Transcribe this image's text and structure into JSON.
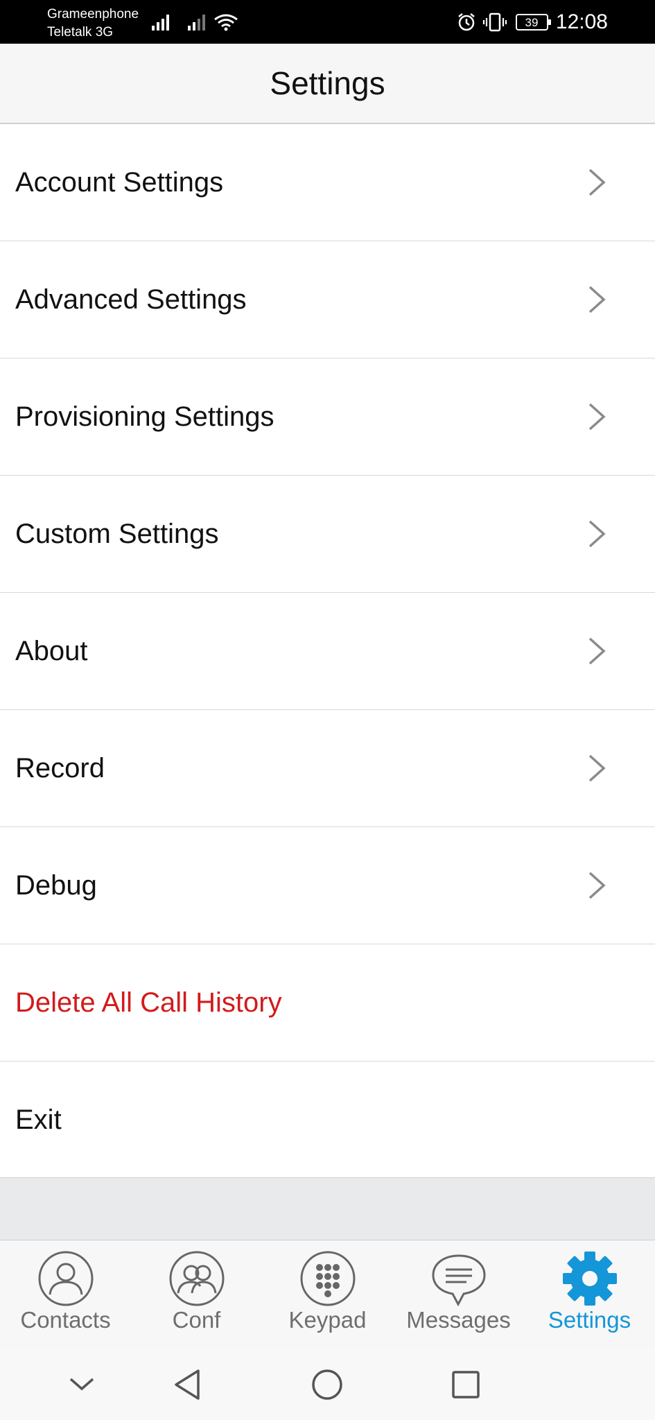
{
  "status_bar": {
    "carrier_1": "Grameenphone",
    "carrier_2": "Teletalk 3G",
    "battery": "39",
    "time": "12:08"
  },
  "header": {
    "title": "Settings"
  },
  "settings_items": [
    {
      "label": "Account Settings",
      "has_chevron": true
    },
    {
      "label": "Advanced Settings",
      "has_chevron": true
    },
    {
      "label": "Provisioning Settings",
      "has_chevron": true
    },
    {
      "label": "Custom Settings",
      "has_chevron": true
    },
    {
      "label": "About",
      "has_chevron": true
    },
    {
      "label": "Record",
      "has_chevron": true
    },
    {
      "label": "Debug",
      "has_chevron": true
    },
    {
      "label": "Delete All Call History",
      "has_chevron": false
    },
    {
      "label": "Exit",
      "has_chevron": false
    }
  ],
  "tabs": [
    {
      "label": "Contacts",
      "icon": "contact-icon",
      "active": false
    },
    {
      "label": "Conf",
      "icon": "conference-icon",
      "active": false
    },
    {
      "label": "Keypad",
      "icon": "keypad-icon",
      "active": false
    },
    {
      "label": "Messages",
      "icon": "messages-icon",
      "active": false
    },
    {
      "label": "Settings",
      "icon": "gear-icon",
      "active": true
    }
  ],
  "colors": {
    "accent": "#1496d8",
    "danger": "#d21b1b",
    "header_bg": "#f6f6f6"
  }
}
